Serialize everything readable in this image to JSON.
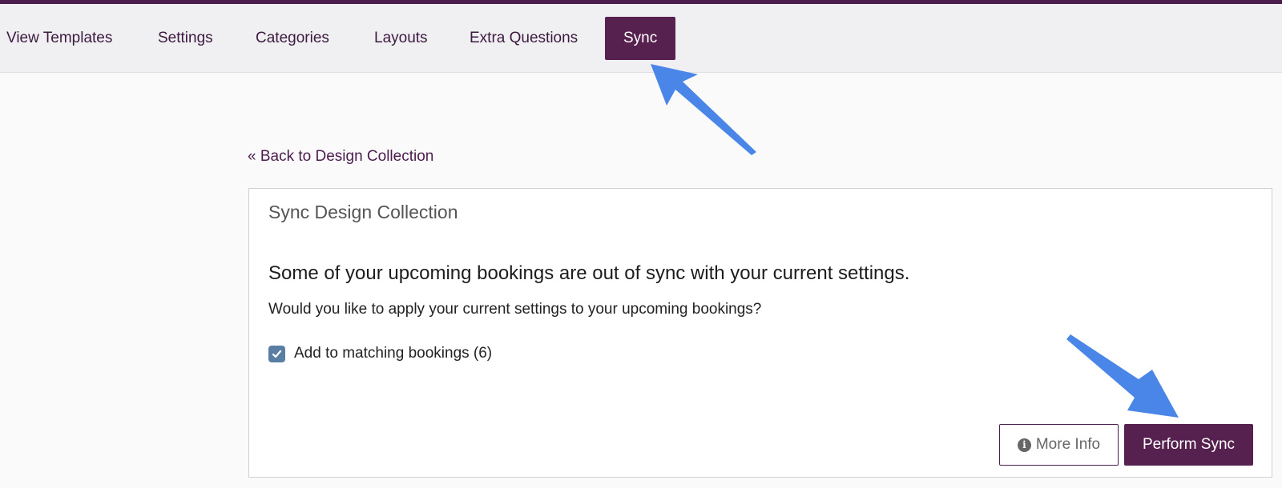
{
  "nav": {
    "tabs": [
      {
        "label": "View Templates"
      },
      {
        "label": "Settings"
      },
      {
        "label": "Categories"
      },
      {
        "label": "Layouts"
      },
      {
        "label": "Extra Questions"
      },
      {
        "label": "Sync"
      }
    ],
    "active_tab": "Sync"
  },
  "back_link": "« Back to Design Collection",
  "panel": {
    "title": "Sync Design Collection",
    "headline": "Some of your upcoming bookings are out of sync with your current settings.",
    "subtext": "Would you like to apply your current settings to your upcoming bookings?",
    "checkbox": {
      "label": "Add to matching bookings (6)",
      "checked": true
    },
    "buttons": {
      "more_info": "More Info",
      "perform_sync": "Perform Sync"
    }
  },
  "colors": {
    "brand": "#56204f",
    "top_strip": "#4b1d4d",
    "checkbox": "#5a7ea3",
    "annotation_arrow": "#4a86e8"
  },
  "icons": {
    "info": "info-circle-icon",
    "check": "check-icon",
    "annotation": "arrow-annotation-icon"
  }
}
